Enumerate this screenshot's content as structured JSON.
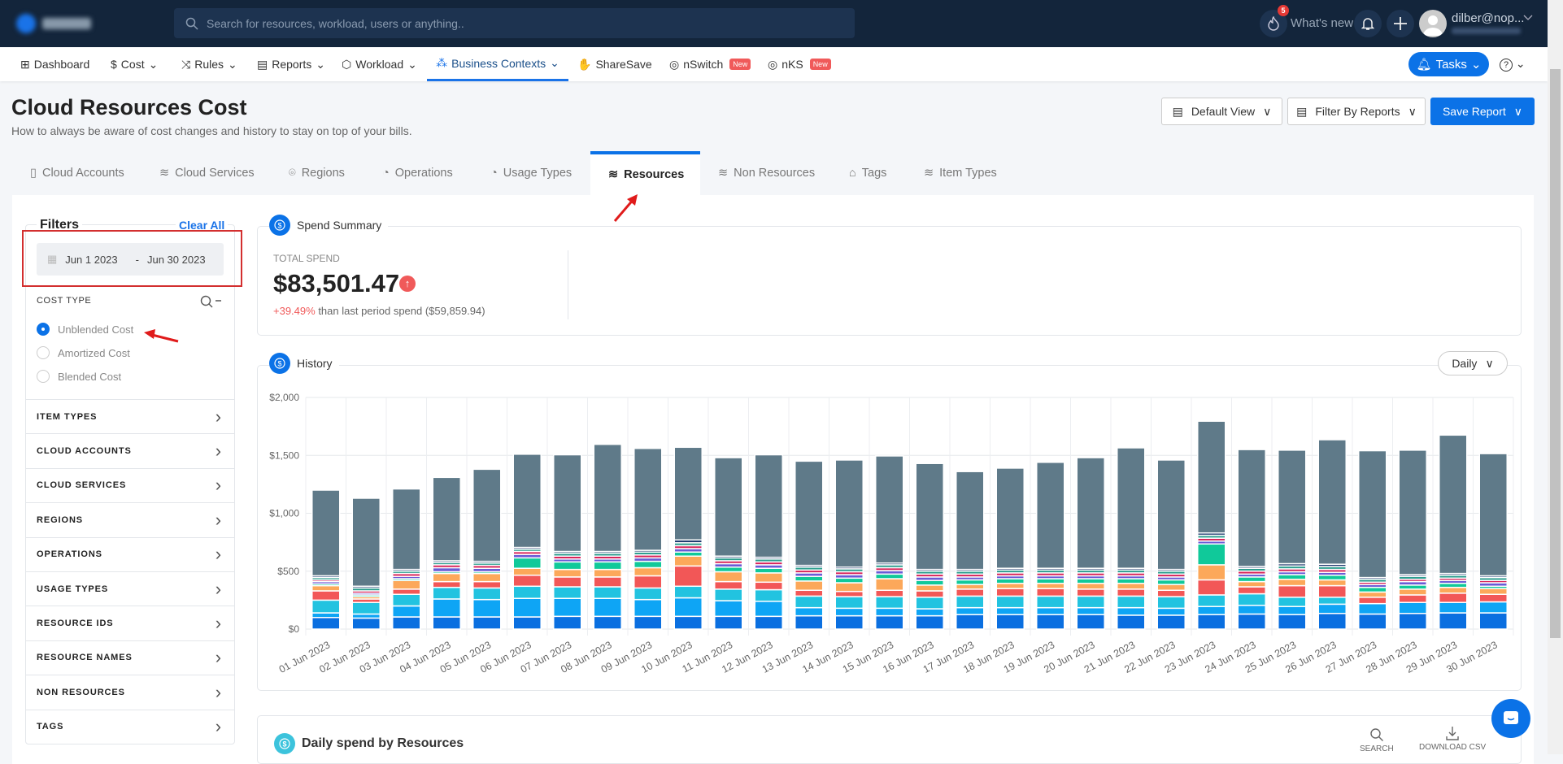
{
  "topbar": {
    "search_placeholder": "Search for resources, workload, users or anything..",
    "whats_new": "What's new",
    "whats_new_badge": "5",
    "user": "dilber@nop..."
  },
  "nav": {
    "items": [
      {
        "label": "Dashboard"
      },
      {
        "label": "Cost"
      },
      {
        "label": "Rules"
      },
      {
        "label": "Reports"
      },
      {
        "label": "Workload"
      },
      {
        "label": "Business Contexts"
      },
      {
        "label": "ShareSave"
      },
      {
        "label": "nSwitch",
        "badge": "New"
      },
      {
        "label": "nKS",
        "badge": "New"
      }
    ],
    "tasks": "Tasks"
  },
  "header": {
    "title": "Cloud Resources Cost",
    "subtitle": "How to always be aware of cost changes and history to stay on top of your bills.",
    "default_view": "Default View",
    "filter_by_reports": "Filter By Reports",
    "save_report": "Save Report"
  },
  "tabs": [
    {
      "label": "Cloud Accounts"
    },
    {
      "label": "Cloud Services"
    },
    {
      "label": "Regions"
    },
    {
      "label": "Operations"
    },
    {
      "label": "Usage Types"
    },
    {
      "label": "Resources",
      "active": true
    },
    {
      "label": "Non Resources"
    },
    {
      "label": "Tags"
    },
    {
      "label": "Item Types"
    }
  ],
  "filters": {
    "title": "Filters",
    "clear_all": "Clear All",
    "date_start": "Jun 1 2023",
    "date_sep": "-",
    "date_end": "Jun 30 2023",
    "cost_type_label": "COST TYPE",
    "cost_types": [
      {
        "label": "Unblended Cost",
        "selected": true
      },
      {
        "label": "Amortized Cost",
        "selected": false
      },
      {
        "label": "Blended Cost",
        "selected": false
      }
    ],
    "groups": [
      "ITEM TYPES",
      "CLOUD ACCOUNTS",
      "CLOUD SERVICES",
      "REGIONS",
      "OPERATIONS",
      "USAGE TYPES",
      "RESOURCE IDS",
      "RESOURCE NAMES",
      "NON RESOURCES",
      "TAGS"
    ]
  },
  "spend_summary": {
    "title": "Spend Summary",
    "total_label": "TOTAL SPEND",
    "total": "$83,501.47",
    "change": "+39.49%",
    "change_text": "than last period spend ($59,859.94)"
  },
  "history": {
    "title": "History",
    "granularity": "Daily"
  },
  "daily_spend": {
    "title": "Daily spend by Resources",
    "search": "SEARCH",
    "download": "DOWNLOAD CSV"
  },
  "colors": {
    "accent": "#0b72e7",
    "negative": "#f05a5a"
  },
  "chart_data": {
    "type": "bar",
    "stacked": true,
    "ylim": [
      0,
      2000
    ],
    "yticks": [
      "$0",
      "$500",
      "$1,000",
      "$1,500",
      "$2,000"
    ],
    "ytick_values": [
      0,
      500,
      1000,
      1500,
      2000
    ],
    "grid": true,
    "categories": [
      "01 Jun 2023",
      "02 Jun 2023",
      "03 Jun 2023",
      "04 Jun 2023",
      "05 Jun 2023",
      "06 Jun 2023",
      "07 Jun 2023",
      "08 Jun 2023",
      "09 Jun 2023",
      "10 Jun 2023",
      "11 Jun 2023",
      "12 Jun 2023",
      "13 Jun 2023",
      "14 Jun 2023",
      "15 Jun 2023",
      "16 Jun 2023",
      "17 Jun 2023",
      "18 Jun 2023",
      "19 Jun 2023",
      "20 Jun 2023",
      "21 Jun 2023",
      "22 Jun 2023",
      "23 Jun 2023",
      "24 Jun 2023",
      "25 Jun 2023",
      "26 Jun 2023",
      "27 Jun 2023",
      "28 Jun 2023",
      "29 Jun 2023",
      "30 Jun 2023"
    ],
    "series": [
      {
        "color": "#0a6fe0",
        "values": [
          100,
          95,
          105,
          105,
          105,
          105,
          110,
          110,
          110,
          110,
          110,
          110,
          115,
          115,
          115,
          115,
          125,
          125,
          125,
          125,
          120,
          120,
          125,
          130,
          125,
          135,
          130,
          135,
          140,
          140
        ]
      },
      {
        "color": "#0ea5f5",
        "values": [
          40,
          35,
          95,
          155,
          150,
          160,
          155,
          155,
          145,
          160,
          135,
          130,
          70,
          65,
          65,
          60,
          60,
          60,
          60,
          60,
          65,
          60,
          70,
          75,
          70,
          80,
          90,
          95,
          90,
          95
        ]
      },
      {
        "color": "#22c3e0",
        "values": [
          110,
          100,
          100,
          100,
          100,
          105,
          100,
          100,
          100,
          100,
          100,
          100,
          100,
          100,
          100,
          100,
          100,
          100,
          100,
          100,
          100,
          100,
          100,
          100,
          80,
          60,
          0,
          0,
          0,
          0
        ]
      },
      {
        "color": "#f25757",
        "values": [
          80,
          30,
          45,
          50,
          55,
          95,
          85,
          85,
          105,
          175,
          65,
          65,
          50,
          45,
          55,
          55,
          60,
          65,
          65,
          60,
          60,
          55,
          130,
          60,
          100,
          100,
          55,
          65,
          80,
          65
        ]
      },
      {
        "color": "#fca85a",
        "values": [
          45,
          20,
          75,
          70,
          70,
          60,
          65,
          65,
          70,
          85,
          85,
          80,
          80,
          75,
          100,
          50,
          40,
          45,
          45,
          50,
          50,
          50,
          130,
          45,
          55,
          50,
          45,
          50,
          50,
          50
        ]
      },
      {
        "color": "#10c99a",
        "values": [
          15,
          15,
          15,
          15,
          15,
          90,
          65,
          65,
          55,
          35,
          40,
          40,
          40,
          40,
          40,
          40,
          40,
          40,
          40,
          40,
          40,
          40,
          180,
          40,
          40,
          40,
          40,
          35,
          35,
          20
        ]
      },
      {
        "color": "#6a5bd6",
        "values": [
          20,
          15,
          20,
          35,
          30,
          30,
          25,
          25,
          30,
          30,
          30,
          30,
          30,
          30,
          30,
          30,
          25,
          25,
          25,
          25,
          25,
          25,
          25,
          25,
          25,
          25,
          25,
          30,
          25,
          30
        ]
      },
      {
        "color": "#d8245a",
        "values": [
          15,
          20,
          25,
          25,
          25,
          25,
          25,
          25,
          25,
          25,
          25,
          25,
          25,
          25,
          25,
          25,
          25,
          25,
          25,
          25,
          25,
          25,
          25,
          25,
          25,
          25,
          20,
          20,
          20,
          20
        ]
      },
      {
        "color": "#2e9e8f",
        "values": [
          20,
          25,
          20,
          20,
          20,
          20,
          25,
          25,
          25,
          25,
          25,
          25,
          25,
          25,
          25,
          25,
          25,
          25,
          25,
          25,
          25,
          25,
          25,
          25,
          25,
          25,
          25,
          25,
          25,
          25
        ]
      },
      {
        "color": "#1e3a6e",
        "values": [
          15,
          15,
          15,
          15,
          15,
          15,
          15,
          15,
          15,
          25,
          15,
          15,
          15,
          15,
          15,
          15,
          15,
          15,
          15,
          15,
          15,
          15,
          20,
          15,
          20,
          20,
          15,
          15,
          15,
          15
        ]
      },
      {
        "color": "#5f7a89",
        "values": [
          740,
          760,
          695,
          720,
          795,
          805,
          835,
          925,
          880,
          800,
          850,
          885,
          900,
          925,
          925,
          915,
          845,
          865,
          915,
          955,
          1040,
          945,
          965,
          1010,
          980,
          1075,
          1095,
          1075,
          1195,
          1055
        ]
      }
    ]
  }
}
